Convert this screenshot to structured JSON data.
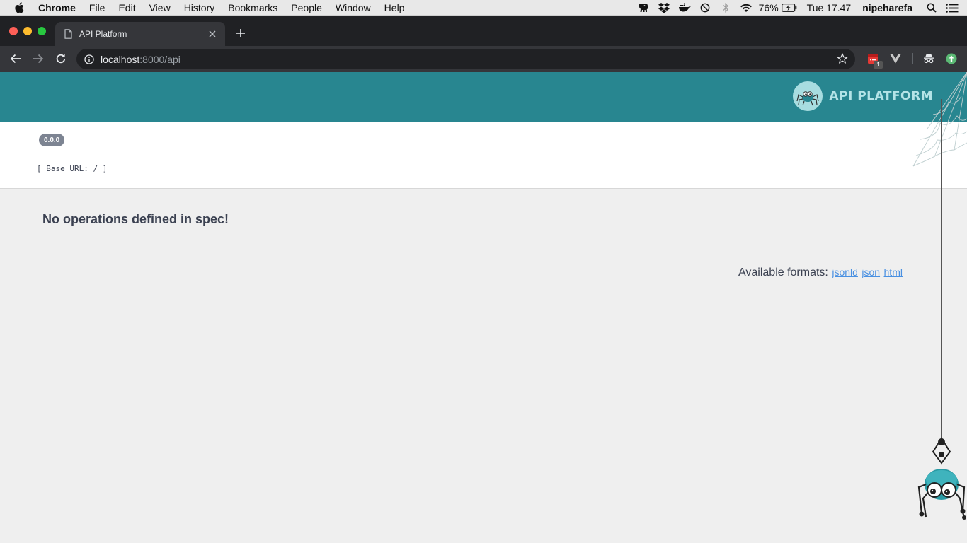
{
  "menubar": {
    "app_name": "Chrome",
    "items": [
      "File",
      "Edit",
      "View",
      "History",
      "Bookmarks",
      "People",
      "Window",
      "Help"
    ],
    "battery": "76%",
    "clock": "Tue 17.47",
    "user": "nipeharefa"
  },
  "browser": {
    "tab_title": "API Platform",
    "url_host": "localhost",
    "url_path": ":8000/api",
    "extension_badge": "1"
  },
  "header": {
    "logo_text": "API PLATFORM"
  },
  "info": {
    "version": "0.0.0",
    "base_url": "[ Base URL: / ]"
  },
  "main": {
    "no_operations": "No operations defined in spec!",
    "formats_label": "Available formats:",
    "formats": [
      "jsonld",
      "json",
      "html"
    ]
  },
  "colors": {
    "header_bg": "#288690",
    "link": "#4990e2",
    "text": "#3b4151",
    "page_bg": "#efefef"
  }
}
